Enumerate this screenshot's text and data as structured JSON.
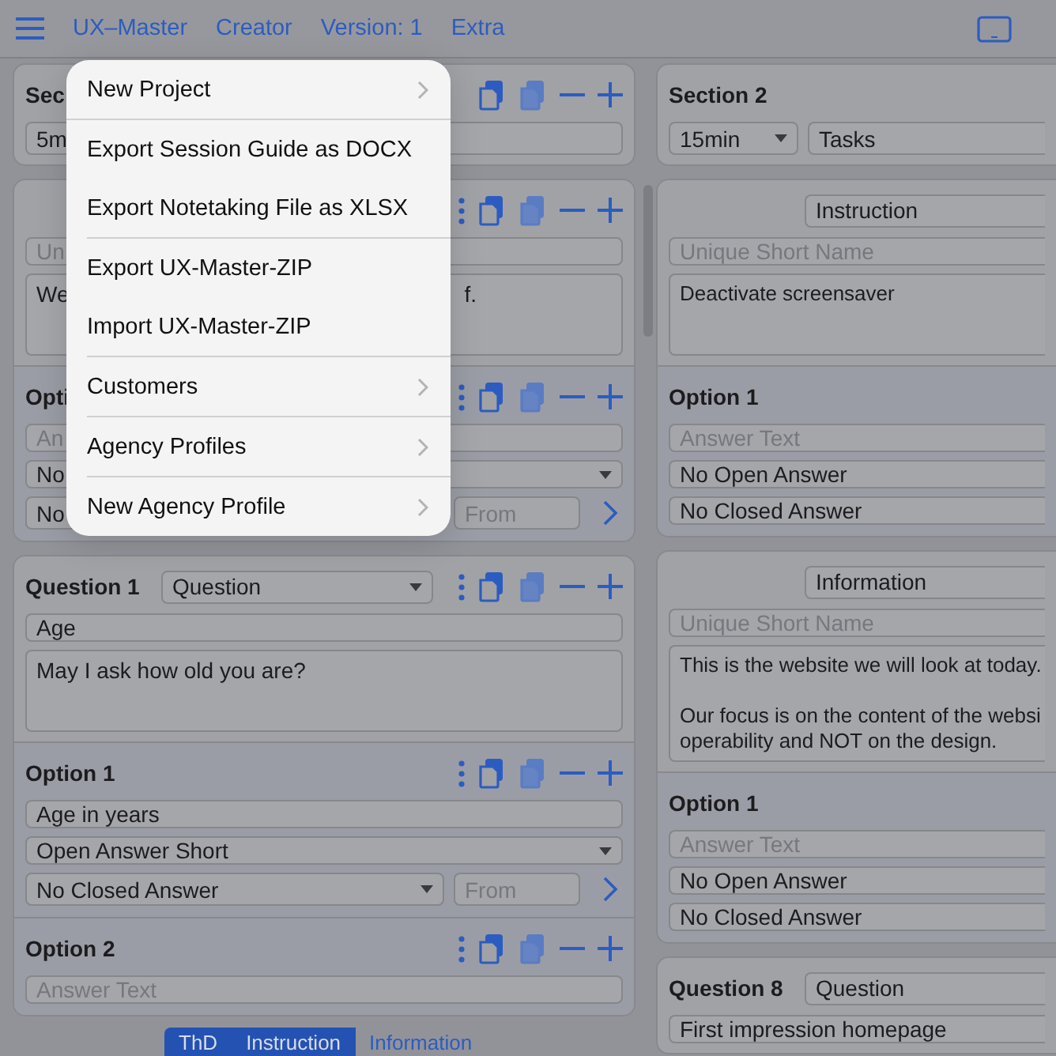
{
  "toolbar": {
    "items": [
      "UX–Master",
      "Creator",
      "Version: 1",
      "Extra"
    ]
  },
  "menu": {
    "items": [
      {
        "label": "New Project",
        "submenu": true,
        "divider_after": true
      },
      {
        "label": "Export Session Guide as DOCX",
        "submenu": false,
        "divider_after": false
      },
      {
        "label": "Export Notetaking File as XLSX",
        "submenu": false,
        "divider_after": true
      },
      {
        "label": "Export UX-Master-ZIP",
        "submenu": false,
        "divider_after": false
      },
      {
        "label": "Import UX-Master-ZIP",
        "submenu": false,
        "divider_after": true
      },
      {
        "label": "Customers",
        "submenu": true,
        "divider_after": true
      },
      {
        "label": "Agency Profiles",
        "submenu": true,
        "divider_after": true
      },
      {
        "label": "New Agency Profile",
        "submenu": true,
        "divider_after": false
      }
    ]
  },
  "left": {
    "section": {
      "title": "Sec",
      "duration": "5m"
    },
    "cards": [
      {
        "short_name": {
          "placeholder": "Un"
        },
        "text_fragments": [
          "We",
          "f."
        ],
        "options": [
          {
            "title": "Opti",
            "answer": {
              "placeholder": "An"
            },
            "open": "No",
            "closed": "No",
            "from": "From"
          }
        ]
      },
      {
        "title": "Question 1",
        "type": "Question",
        "short_name": {
          "value": "Age"
        },
        "text": "May I ask how old you are?",
        "options": [
          {
            "title": "Option 1",
            "answer": {
              "value": "Age in years"
            },
            "open": "Open Answer Short",
            "closed": "No Closed Answer",
            "from": "From"
          },
          {
            "title": "Option 2",
            "answer": {
              "placeholder": "Answer Text"
            }
          }
        ]
      }
    ]
  },
  "right": {
    "section": {
      "title": "Section 2",
      "duration": "15min",
      "name": "Tasks"
    },
    "cards": [
      {
        "type": "Instruction",
        "short_name": {
          "placeholder": "Unique Short Name"
        },
        "text": "Deactivate screensaver",
        "options": [
          {
            "title": "Option 1",
            "answer": {
              "placeholder": "Answer Text"
            },
            "open": "No Open Answer",
            "closed": "No Closed Answer"
          }
        ]
      },
      {
        "type": "Information",
        "short_name": {
          "placeholder": "Unique Short Name"
        },
        "text": "This is the website we will look at today.\n\nOur focus is on the content of the websi\noperability and NOT on the design.",
        "options": [
          {
            "title": "Option 1",
            "answer": {
              "placeholder": "Answer Text"
            },
            "open": "No Open Answer",
            "closed": "No Closed Answer"
          }
        ]
      },
      {
        "title": "Question 8",
        "type": "Question",
        "short_name": {
          "value": "First impression homepage"
        }
      }
    ]
  },
  "segments": [
    {
      "label": "ThD",
      "selected": true
    },
    {
      "label": "Instruction",
      "selected": true
    },
    {
      "label": "Information",
      "selected": false
    }
  ]
}
